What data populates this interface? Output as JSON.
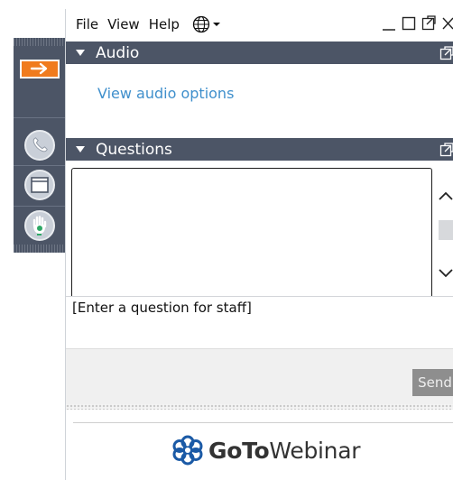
{
  "menu": {
    "file": "File",
    "view": "View",
    "help": "Help"
  },
  "icons": {
    "language": "globe-icon",
    "minimize": "minimize-icon",
    "maximize": "maximize-icon",
    "popout": "popout-icon",
    "close": "close-icon",
    "sidebar": [
      "arrow-right-icon",
      "phone-icon",
      "window-icon",
      "raise-hand-icon"
    ]
  },
  "audio": {
    "title": "Audio",
    "link": "View audio options"
  },
  "questions": {
    "title": "Questions",
    "placeholder": "[Enter a question for staff]",
    "send_label": "Send"
  },
  "branding": {
    "logo_bold": "GoTo",
    "logo_regular": "Webinar"
  },
  "colors": {
    "header_bg": "#4c5566",
    "accent_orange": "#f07b1e",
    "link_blue": "#3f8fcc",
    "send_disabled": "#8e8e8e"
  }
}
